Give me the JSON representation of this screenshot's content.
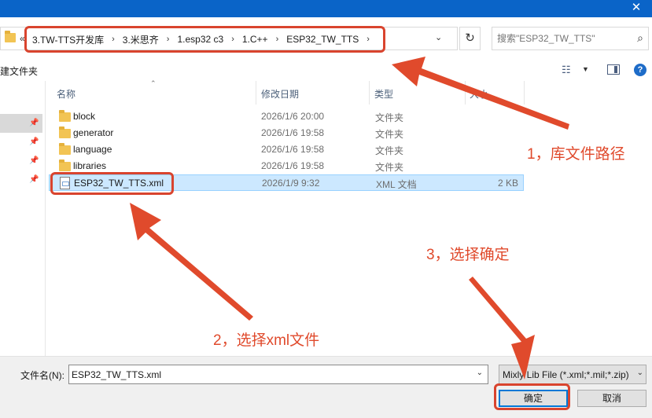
{
  "address": {
    "overflow_glyph": "«",
    "crumbs": [
      "3.TW-TTS开发库",
      "3.米思齐",
      "1.esp32 c3",
      "1.C++",
      "ESP32_TW_TTS"
    ],
    "separator": "›",
    "dropdown_glyph": "⌄",
    "refresh_glyph": "↻"
  },
  "search": {
    "placeholder": "搜索\"ESP32_TW_TTS\"",
    "icon_glyph": "⌕"
  },
  "toolbar": {
    "new_folder": "建文件夹",
    "help_glyph": "?"
  },
  "columns": {
    "name": "名称",
    "date": "修改日期",
    "type": "类型",
    "size": "大小"
  },
  "files": [
    {
      "name": "block",
      "date": "2026/1/6 20:00",
      "type": "文件夹",
      "size": "",
      "kind": "folder"
    },
    {
      "name": "generator",
      "date": "2026/1/6 19:58",
      "type": "文件夹",
      "size": "",
      "kind": "folder"
    },
    {
      "name": "language",
      "date": "2026/1/6 19:58",
      "type": "文件夹",
      "size": "",
      "kind": "folder"
    },
    {
      "name": "libraries",
      "date": "2026/1/6 19:58",
      "type": "文件夹",
      "size": "",
      "kind": "folder"
    },
    {
      "name": "ESP32_TW_TTS.xml",
      "date": "2026/1/9 9:32",
      "type": "XML 文档",
      "size": "2 KB",
      "kind": "xml",
      "selected": true
    }
  ],
  "filename": {
    "label": "文件名(N):",
    "value": "ESP32_TW_TTS.xml"
  },
  "filetype": {
    "value": "Mixly Lib File (*.xml;*.mil;*.zip)"
  },
  "buttons": {
    "ok": "确定",
    "cancel": "取消"
  },
  "annotations": {
    "a1": "1，库文件路径",
    "a2": "2，选择xml文件",
    "a3": "3，选择确定"
  },
  "colors": {
    "annotation": "#e04a2c",
    "selection": "#cce8ff",
    "titlebar": "#0a64c8"
  }
}
